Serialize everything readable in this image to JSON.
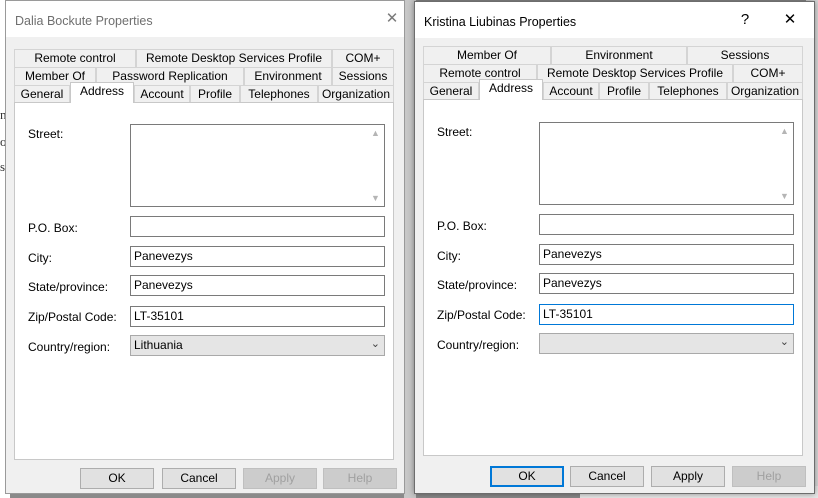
{
  "background": {
    "left_fragments": [
      "n",
      "o",
      "st"
    ]
  },
  "dialogs": [
    {
      "title": "Dalia Bockute Properties",
      "close_glyph": "✕",
      "tab_rows": [
        [
          "Remote control",
          "Remote Desktop Services Profile",
          "COM+"
        ],
        [
          "Member Of",
          "Password Replication",
          "Environment",
          "Sessions"
        ],
        [
          "General",
          "Address",
          "Account",
          "Profile",
          "Telephones",
          "Organization"
        ]
      ],
      "active_tab": "Address",
      "labels": {
        "street": "Street:",
        "po_box": "P.O. Box:",
        "city": "City:",
        "state": "State/province:",
        "zip": "Zip/Postal Code:",
        "country": "Country/region:"
      },
      "values": {
        "street": "",
        "po_box": "",
        "city": "Panevezys",
        "state": "Panevezys",
        "zip": "LT-35101",
        "country": "Lithuania"
      },
      "buttons": {
        "ok": "OK",
        "cancel": "Cancel",
        "apply": "Apply",
        "help": "Help"
      }
    },
    {
      "title": "Kristina Liubinas Properties",
      "help_glyph": "?",
      "close_glyph": "✕",
      "tab_rows": [
        [
          "Member Of",
          "Environment",
          "Sessions"
        ],
        [
          "Remote control",
          "Remote Desktop Services Profile",
          "COM+"
        ],
        [
          "General",
          "Address",
          "Account",
          "Profile",
          "Telephones",
          "Organization"
        ]
      ],
      "active_tab": "Address",
      "labels": {
        "street": "Street:",
        "po_box": "P.O. Box:",
        "city": "City:",
        "state": "State/province:",
        "zip": "Zip/Postal Code:",
        "country": "Country/region:"
      },
      "values": {
        "street": "",
        "po_box": "",
        "city": "Panevezys",
        "state": "Panevezys",
        "zip": "LT-35101",
        "country": ""
      },
      "buttons": {
        "ok": "OK",
        "cancel": "Cancel",
        "apply": "Apply",
        "help": "Help"
      }
    }
  ]
}
